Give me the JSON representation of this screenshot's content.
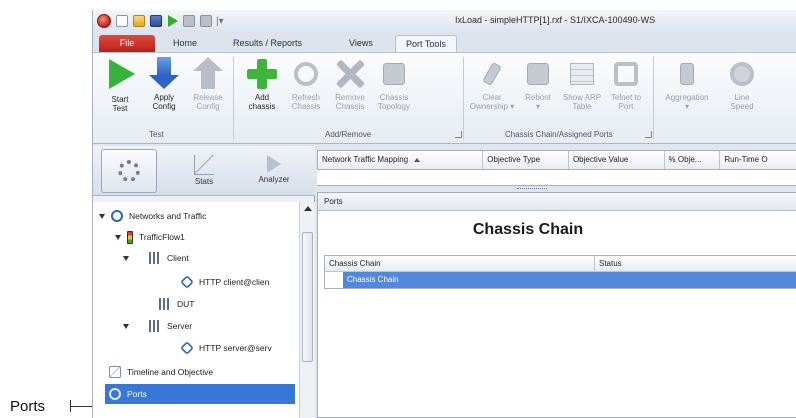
{
  "callout": {
    "label": "Ports"
  },
  "window": {
    "title": "IxLoad - simpleHTTP[1].rxf - S1/IXCA-100490-WS"
  },
  "menu_tabs": [
    "File",
    "Home",
    "Results / Reports",
    "Views",
    "Port Tools"
  ],
  "ribbon": {
    "buttons": [
      {
        "label1": "Start",
        "label2": "Test",
        "enabled": true
      },
      {
        "label1": "Apply",
        "label2": "Config",
        "enabled": true
      },
      {
        "label1": "Release",
        "label2": "Config",
        "enabled": false
      },
      {
        "label1": "Add",
        "label2": "chassis",
        "enabled": true
      },
      {
        "label1": "Refresh",
        "label2": "Chassis",
        "enabled": false
      },
      {
        "label1": "Remove",
        "label2": "Chassis",
        "enabled": false
      },
      {
        "label1": "Chassis",
        "label2": "Topology",
        "enabled": false
      },
      {
        "label1": "Clear",
        "label2": "Ownership ▾",
        "enabled": false
      },
      {
        "label1": "Reboot",
        "label2": "▾",
        "enabled": false
      },
      {
        "label1": "Show ARP",
        "label2": "Table",
        "enabled": false
      },
      {
        "label1": "Telnet to",
        "label2": "Port",
        "enabled": false
      },
      {
        "label1": "Aggregation",
        "label2": "▾",
        "enabled": false
      },
      {
        "label1": "Line",
        "label2": "Speed",
        "enabled": false
      }
    ],
    "groups": [
      "Test",
      "Add/Remove",
      "Chassis Chain/Assigned Ports"
    ]
  },
  "left_tabs": [
    {
      "label": ""
    },
    {
      "label": "Stats"
    },
    {
      "label": "Analyzer"
    }
  ],
  "tree": [
    {
      "label": "Networks and Traffic",
      "icon": "network-icon"
    },
    {
      "label": "TrafficFlow1",
      "icon": "traffic-light-icon"
    },
    {
      "label": "Client",
      "icon": "client-icon"
    },
    {
      "label": "HTTP client@clien",
      "icon": "protocol-icon"
    },
    {
      "label": "DUT",
      "icon": "client-icon"
    },
    {
      "label": "Server",
      "icon": "client-icon"
    },
    {
      "label": "HTTP server@serv",
      "icon": "protocol-icon"
    },
    {
      "label": "Timeline and Objective",
      "icon": "timeline-icon"
    },
    {
      "label": "Ports",
      "icon": "ports-icon"
    }
  ],
  "grid_columns": [
    "Network Traffic Mapping",
    "Objective Type",
    "Objective Value",
    "% Obje...",
    "Run-Time O"
  ],
  "ports_panel": {
    "header": "Ports",
    "title": "Chassis Chain",
    "columns": [
      "Chassis Chain",
      "Status"
    ],
    "rows": [
      {
        "chain": "Chassis Chain",
        "status": ""
      }
    ]
  }
}
